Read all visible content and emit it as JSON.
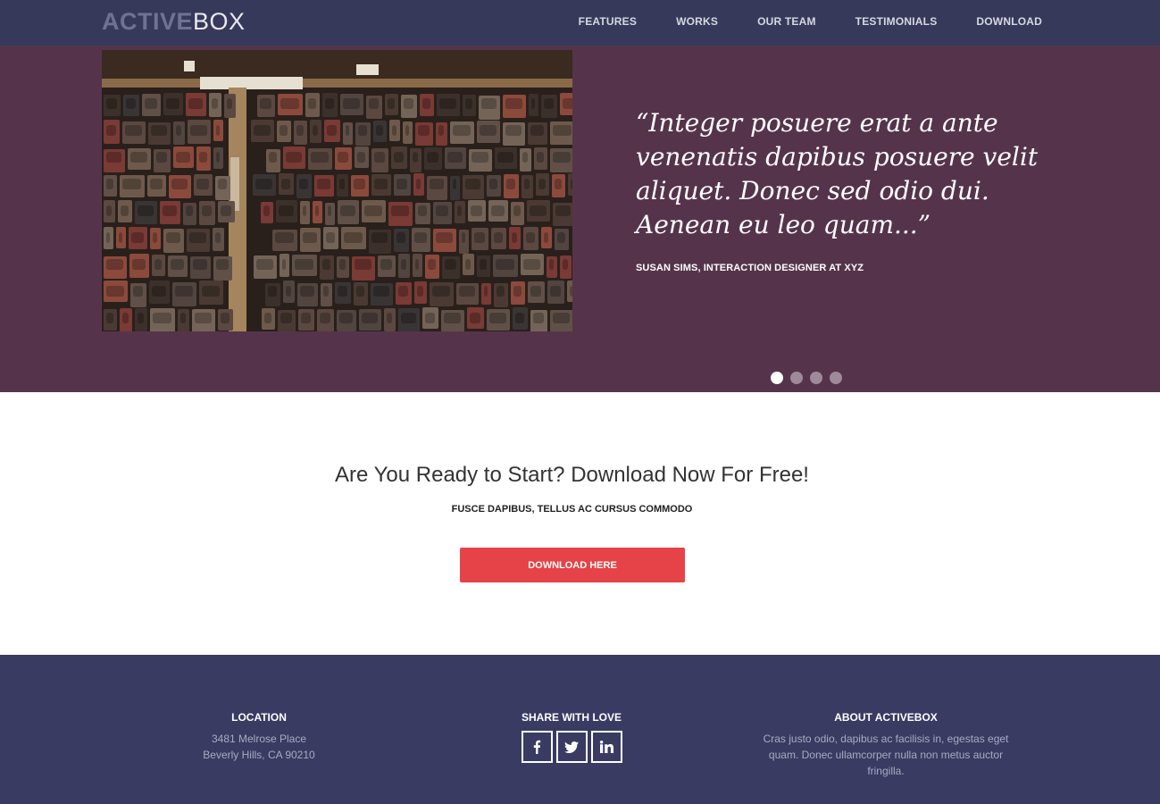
{
  "navbar": {
    "logo_part1": "ACTIVE",
    "logo_part2": "BOX",
    "items": [
      {
        "label": "FEATURES"
      },
      {
        "label": "WORKS"
      },
      {
        "label": "OUR TEAM"
      },
      {
        "label": "TESTIMONIALS"
      },
      {
        "label": "DOWNLOAD"
      }
    ]
  },
  "hero": {
    "quote": "“Integer posuere erat a ante venenatis dapibus posuere velit aliquet. Donec sed odio dui. Aenean eu leo quam...”",
    "author": "SUSAN SIMS, INTERACTION DESIGNER AT XYZ",
    "slides": 4,
    "active_slide": 1
  },
  "cta": {
    "title": "Are You Ready to Start? Download Now For Free!",
    "subtitle": "FUSCE DAPIBUS, TELLUS AC CURSUS COMMODO",
    "button_label": "DOWNLOAD HERE"
  },
  "footer": {
    "location": {
      "title": "LOCATION",
      "line1": "3481 Melrose Place",
      "line2": "Beverly Hills, CA 90210"
    },
    "share": {
      "title": "SHARE WITH LOVE",
      "icons": [
        "facebook-icon",
        "twitter-icon",
        "linkedin-icon"
      ]
    },
    "about": {
      "title": "ABOUT ACTIVEBOX",
      "text": "Cras justo odio, dapibus ac facilisis in, egestas eget quam. Donec ullamcorper nulla non metus auctor fringilla."
    }
  },
  "colors": {
    "navbar_bg": "#36395a",
    "hero_bg": "#55344b",
    "accent": "#e54347",
    "footer_bg": "#393b62"
  }
}
